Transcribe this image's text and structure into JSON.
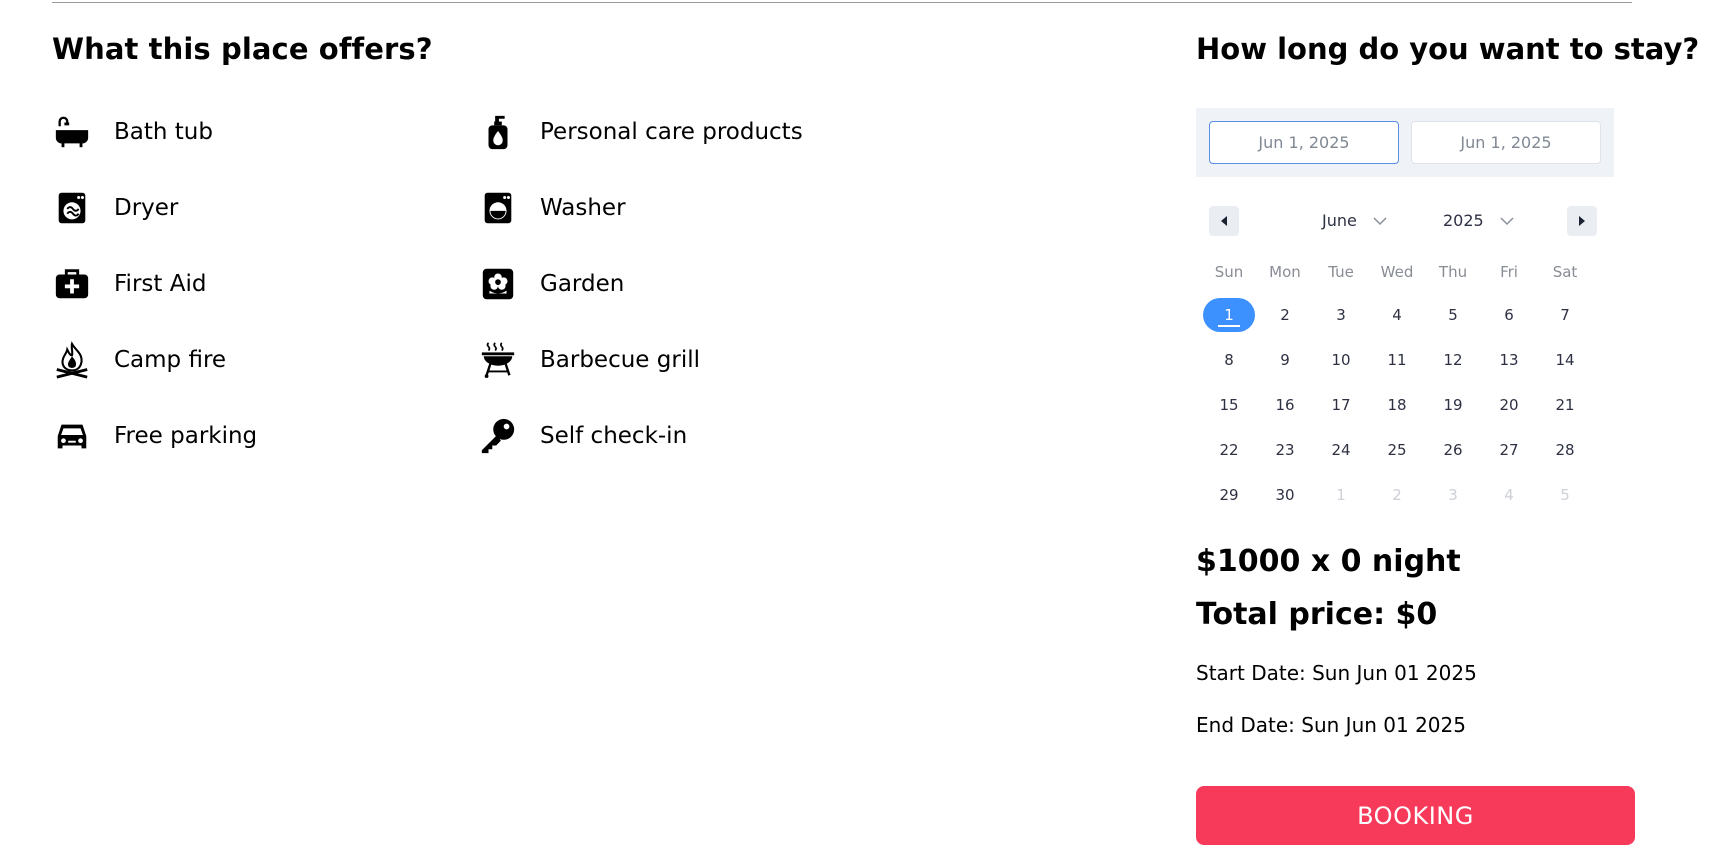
{
  "offers": {
    "title": "What this place offers?",
    "left": [
      {
        "label": "Bath tub",
        "icon": "bath-tub-icon"
      },
      {
        "label": "Dryer",
        "icon": "dryer-icon"
      },
      {
        "label": "First Aid",
        "icon": "first-aid-icon"
      },
      {
        "label": "Camp fire",
        "icon": "camp-fire-icon"
      },
      {
        "label": "Free parking",
        "icon": "car-icon"
      }
    ],
    "right": [
      {
        "label": "Personal care products",
        "icon": "soap-bottle-icon"
      },
      {
        "label": "Washer",
        "icon": "washer-icon"
      },
      {
        "label": "Garden",
        "icon": "garden-icon"
      },
      {
        "label": "Barbecue grill",
        "icon": "barbecue-grill-icon"
      },
      {
        "label": "Self check-in",
        "icon": "key-icon"
      }
    ]
  },
  "booking": {
    "title": "How long do you want to stay?",
    "start_input": "Jun 1, 2025",
    "end_input": "Jun 1, 2025",
    "month": "June",
    "year": "2025",
    "weekdays": [
      "Sun",
      "Mon",
      "Tue",
      "Wed",
      "Thu",
      "Fri",
      "Sat"
    ],
    "days": [
      [
        "1",
        "2",
        "3",
        "4",
        "5",
        "6",
        "7"
      ],
      [
        "8",
        "9",
        "10",
        "11",
        "12",
        "13",
        "14"
      ],
      [
        "15",
        "16",
        "17",
        "18",
        "19",
        "20",
        "21"
      ],
      [
        "22",
        "23",
        "24",
        "25",
        "26",
        "27",
        "28"
      ],
      [
        "29",
        "30",
        "1",
        "2",
        "3",
        "4",
        "5"
      ]
    ],
    "price_per_night": "$1000 x 0 night",
    "total_price": "Total price: $0",
    "start_date": "Start Date: Sun Jun 01 2025",
    "end_date": "End Date: Sun Jun 01 2025",
    "button_label": "BOOKING",
    "colors": {
      "accent": "#f83a5a",
      "selected_day": "#3d91ff"
    }
  }
}
